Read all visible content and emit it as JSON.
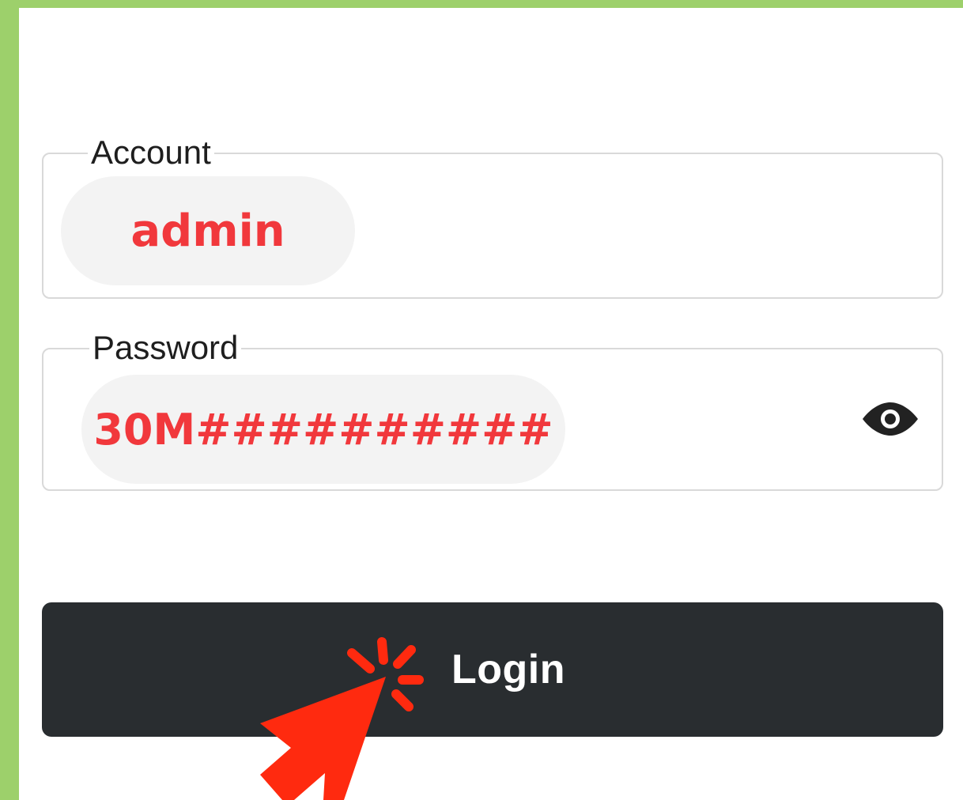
{
  "form": {
    "account": {
      "label": "Account",
      "value": "admin"
    },
    "password": {
      "label": "Password",
      "value": "30M##########",
      "toggle_icon": "eye-icon"
    },
    "login_button": {
      "label": "Login"
    }
  },
  "annotation": {
    "cursor_icon": "click-cursor-icon"
  },
  "colors": {
    "frame": "#9dd06b",
    "value_text": "#f1383c",
    "pill_background": "#f3f3f3",
    "button_background": "#292d30",
    "cursor": "#ff2a0f"
  }
}
